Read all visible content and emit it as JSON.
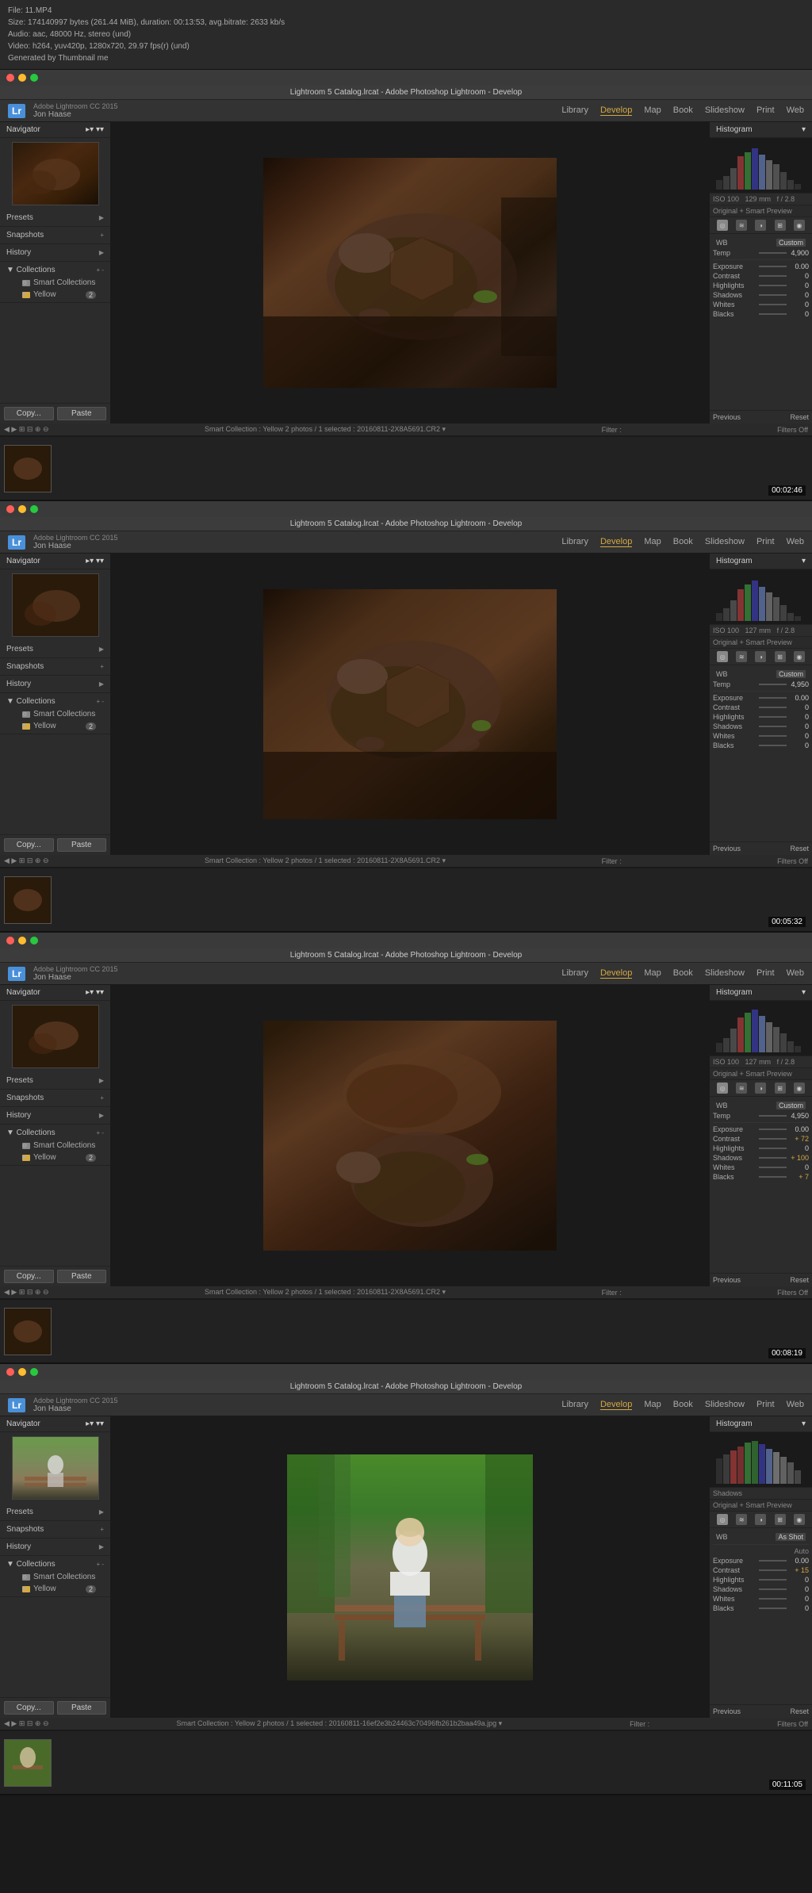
{
  "file": {
    "name": "File: 11.MP4",
    "size": "Size: 174140997 bytes (261.44 MiB), duration: 00:13:53, avg.bitrate: 2633 kb/s",
    "audio": "Audio: aac, 48000 Hz, stereo (und)",
    "video": "Video: h264, yuv420p, 1280x720, 29.97 fps(r) (und)",
    "generated": "Generated by Thumbnail me"
  },
  "frames": [
    {
      "timestamp": "00:02:46",
      "title": "Lightroom 5 Catalog.lrcat - Adobe Photoshop Lightroom - Develop",
      "nav_items": [
        "Library",
        "Develop",
        "Map",
        "Book",
        "Slideshow",
        "Print",
        "Web"
      ],
      "active_nav": "Develop",
      "user": "Jon Haase",
      "histogram_label": "Histogram",
      "panel_items": [
        "Navigator",
        "Presets",
        "Snapshots",
        "History",
        "Collections"
      ],
      "collections_sub": [
        "Smart Collections",
        "Yellow"
      ],
      "yellow_badge": "2",
      "copy_label": "Copy...",
      "paste_label": "Paste",
      "wb": "Custom",
      "temp": "4,900",
      "preview_text": "Original + Smart Preview",
      "exposure": "0.00",
      "contrast": "0",
      "highlights": "0",
      "shadows": "0",
      "whites": "0",
      "blacks": "0",
      "prev_btn": "Previous",
      "reset_btn": "Reset",
      "status_text": "Smart Collection : Yellow  2 photos / 1 selected : 20160811-2X8A5691.CR2 ▾",
      "filter_text": "Filter :",
      "filters_off": "Filters Off",
      "iso": "ISO 100",
      "focal": "129 mm",
      "aperture": "f / 2.8"
    },
    {
      "timestamp": "00:05:32",
      "title": "Lightroom 5 Catalog.lrcat - Adobe Photoshop Lightroom - Develop",
      "nav_items": [
        "Library",
        "Develop",
        "Map",
        "Book",
        "Slideshow",
        "Print",
        "Web"
      ],
      "active_nav": "Develop",
      "user": "Jon Haase",
      "histogram_label": "Histogram",
      "panel_items": [
        "Navigator",
        "Presets",
        "Snapshots",
        "History",
        "Collections"
      ],
      "collections_sub": [
        "Smart Collections",
        "Yellow"
      ],
      "yellow_badge": "2",
      "copy_label": "Copy...",
      "paste_label": "Paste",
      "wb": "Custom",
      "temp": "4,950",
      "preview_text": "Original + Smart Preview",
      "exposure": "0.00",
      "contrast": "0",
      "highlights": "0",
      "shadows": "0",
      "whites": "0",
      "blacks": "0",
      "prev_btn": "Previous",
      "reset_btn": "Reset",
      "status_text": "Smart Collection : Yellow  2 photos / 1 selected : 20160811-2X8A5691.CR2 ▾",
      "filter_text": "Filter :",
      "filters_off": "Filters Off",
      "iso": "ISO 100",
      "focal": "127 mm",
      "aperture": "f / 2.8"
    },
    {
      "timestamp": "00:08:19",
      "title": "Lightroom 5 Catalog.lrcat - Adobe Photoshop Lightroom - Develop",
      "nav_items": [
        "Library",
        "Develop",
        "Map",
        "Book",
        "Slideshow",
        "Print",
        "Web"
      ],
      "active_nav": "Develop",
      "user": "Jon Haase",
      "histogram_label": "Histogram",
      "panel_items": [
        "Navigator",
        "Presets",
        "Snapshots",
        "History",
        "Collections"
      ],
      "collections_sub": [
        "Smart Collections",
        "Yellow"
      ],
      "yellow_badge": "2",
      "copy_label": "Copy...",
      "paste_label": "Paste",
      "wb": "Custom",
      "temp": "4,950",
      "preview_text": "Original + Smart Preview",
      "exposure": "0.00",
      "contrast": "+ 72",
      "highlights": "0",
      "shadows": "+ 100",
      "whites": "0",
      "blacks": "+ 7",
      "prev_btn": "Previous",
      "reset_btn": "Reset",
      "status_text": "Smart Collection : Yellow  2 photos / 1 selected : 20160811-2X8A5691.CR2 ▾",
      "filter_text": "Filter :",
      "filters_off": "Filters Off",
      "iso": "ISO 100",
      "focal": "127 mm",
      "aperture": "f / 2.8"
    },
    {
      "timestamp": "00:11:05",
      "title": "Lightroom 5 Catalog.lrcat - Adobe Photoshop Lightroom - Develop",
      "nav_items": [
        "Library",
        "Develop",
        "Map",
        "Book",
        "Slideshow",
        "Print",
        "Web"
      ],
      "active_nav": "Develop",
      "user": "Jon Haase",
      "histogram_label": "Histogram",
      "panel_items": [
        "Navigator",
        "Presets",
        "Snapshots",
        "History",
        "Collections"
      ],
      "collections_sub": [
        "Smart Collections",
        "Yellow"
      ],
      "yellow_badge": "2",
      "copy_label": "Copy...",
      "paste_label": "Paste",
      "wb": "As Shot",
      "temp": "",
      "preview_text": "Original + Smart Preview",
      "exposure": "0.00",
      "contrast": "+ 15",
      "highlights": "0",
      "shadows": "0",
      "whites": "0",
      "blacks": "0",
      "prev_btn": "Previous",
      "reset_btn": "Reset",
      "status_text": "Smart Collection : Yellow  2 photos / 1 selected : 20160811-16ef2e3b24463c70496fb261b2baa49a.jpg ▾",
      "filter_text": "Filter :",
      "filters_off": "Filters Off",
      "iso": "",
      "focal": "",
      "aperture": ""
    }
  ]
}
